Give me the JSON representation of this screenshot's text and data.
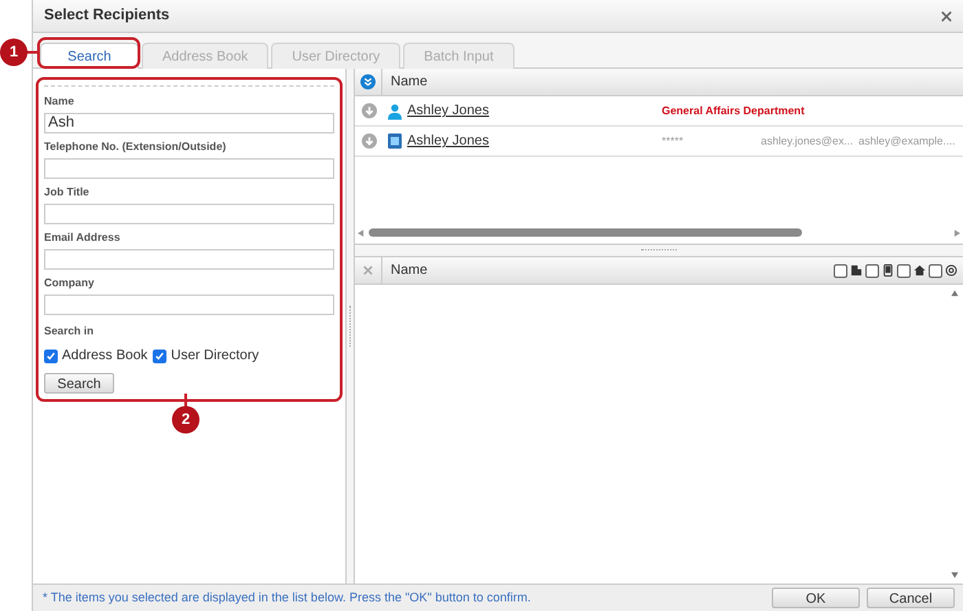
{
  "window": {
    "title": "Select Recipients"
  },
  "callouts": [
    "1",
    "2"
  ],
  "tabs": [
    {
      "label": "Search",
      "selected": true
    },
    {
      "label": "Address Book",
      "selected": false
    },
    {
      "label": "User Directory",
      "selected": false
    },
    {
      "label": "Batch Input",
      "selected": false
    }
  ],
  "form": {
    "fields": [
      {
        "label": "Name",
        "value": "Ash"
      },
      {
        "label": "Telephone No. (Extension/Outside)"
      },
      {
        "label": "Job Title"
      },
      {
        "label": "Email Address"
      },
      {
        "label": "Company"
      }
    ],
    "search_in_label": "Search in",
    "sources": [
      {
        "label": "Address Book",
        "checked": true
      },
      {
        "label": "User Directory",
        "checked": true
      }
    ],
    "button": "Search"
  },
  "results": {
    "column": "Name",
    "rows": [
      {
        "kind": "user",
        "name": "Ashley Jones",
        "department": "General Affairs Department"
      },
      {
        "kind": "contact",
        "name": "Ashley Jones",
        "phone": "*****",
        "email_1": "ashley.jones@ex...",
        "email_2": "ashley@example...."
      }
    ]
  },
  "selected_list": {
    "column": "Name",
    "filters": [
      {
        "kind": "company",
        "checked": false
      },
      {
        "kind": "mobile",
        "checked": false
      },
      {
        "kind": "home",
        "checked": false
      },
      {
        "kind": "email",
        "checked": false
      }
    ]
  },
  "footer": {
    "note": "* The items you selected are displayed in the list below. Press the \"OK\" button to confirm.",
    "buttons": [
      "OK",
      "Cancel"
    ]
  }
}
